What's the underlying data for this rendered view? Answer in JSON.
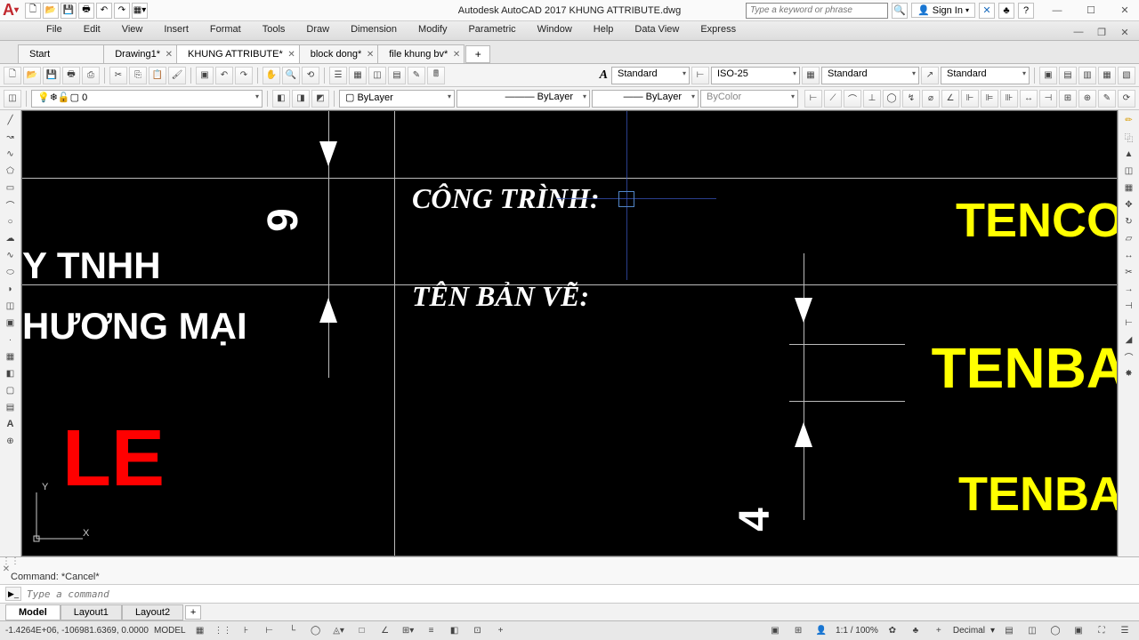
{
  "app": {
    "title": "Autodesk AutoCAD 2017   KHUNG ATTRIBUTE.dwg",
    "search_placeholder": "Type a keyword or phrase",
    "sign_in": "Sign In"
  },
  "menu": [
    "File",
    "Edit",
    "View",
    "Insert",
    "Format",
    "Tools",
    "Draw",
    "Dimension",
    "Modify",
    "Parametric",
    "Window",
    "Help",
    "Data View",
    "Express"
  ],
  "tabs": [
    {
      "label": "Start",
      "close": false
    },
    {
      "label": "Drawing1*",
      "close": true
    },
    {
      "label": "KHUNG ATTRIBUTE*",
      "close": true,
      "active": true
    },
    {
      "label": "block dong*",
      "close": true
    },
    {
      "label": "file khung bv*",
      "close": true
    }
  ],
  "props": {
    "textstyle": "Standard",
    "dimstyle": "ISO-25",
    "tablestyle": "Standard",
    "mlstyle": "Standard",
    "layer": "0",
    "linelayer": "ByLayer",
    "ltype": "ByLayer",
    "lwt": "ByLayer",
    "color": "ByColor"
  },
  "canvas": {
    "t1": "Y TNHH",
    "t2": "HƯƠNG MẠI",
    "t3": "LE",
    "t4": "CÔNG TRÌNH:",
    "t5": "TÊN BẢN VẼ:",
    "t6": "TENCO",
    "t7": "TENBA",
    "t8": "TENBA",
    "d1": "9",
    "d2": "4"
  },
  "cmd": {
    "history": "Command: *Cancel*",
    "placeholder": "Type a command"
  },
  "sheets": [
    "Model",
    "Layout1",
    "Layout2"
  ],
  "status": {
    "coords": "-1.4264E+06, -106981.6369, 0.0000",
    "space": "MODEL",
    "scale": "1:1 / 100%",
    "units": "Decimal"
  }
}
